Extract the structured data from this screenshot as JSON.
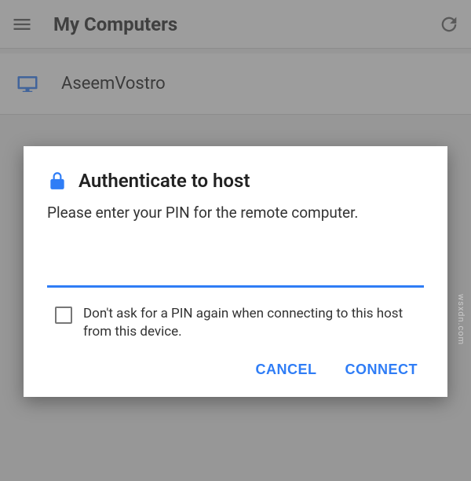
{
  "header": {
    "title": "My Computers"
  },
  "computers": [
    {
      "name": "AseemVostro"
    }
  ],
  "dialog": {
    "title": "Authenticate to host",
    "message": "Please enter your PIN for the remote computer.",
    "pin_value": "",
    "pin_placeholder": "",
    "remember_label": "Don't ask for a PIN again when connecting to this host from this device.",
    "cancel": "CANCEL",
    "connect": "CONNECT"
  },
  "watermark": "wsxdn.com"
}
